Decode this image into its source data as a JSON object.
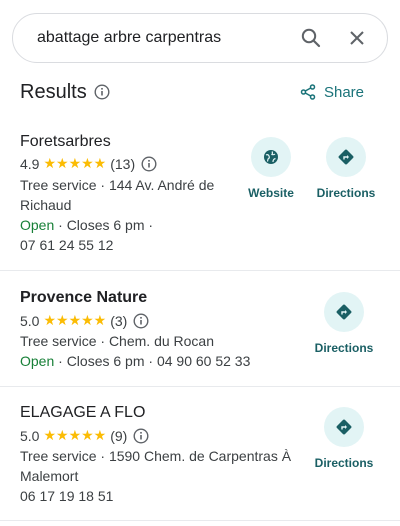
{
  "search": {
    "query": "abattage arbre carpentras"
  },
  "header": {
    "title": "Results",
    "share_label": "Share"
  },
  "actions": {
    "website_label": "Website",
    "directions_label": "Directions"
  },
  "colors": {
    "accent": "#1a7379",
    "open": "#188038",
    "star": "#fbbc04",
    "action_bg": "#e2f4f5"
  },
  "results": [
    {
      "name": "Foretsarbres",
      "rating": "4.9",
      "stars": "★★★★★",
      "review_count": "(13)",
      "line1": "Tree service · 144 Av. André de",
      "line2": "Richaud",
      "status": "Open",
      "hours": " · Closes 6 pm ·",
      "phone": "07 61 24 55 12"
    },
    {
      "name": "Provence Nature",
      "rating": "5.0",
      "stars": "★★★★★",
      "review_count": "(3)",
      "line1": "Tree service · Chem. du Rocan",
      "status": "Open",
      "hours": " · Closes 6 pm · 04 90 60 52 33"
    },
    {
      "name": "ELAGAGE A FLO",
      "rating": "5.0",
      "stars": "★★★★★",
      "review_count": "(9)",
      "line1": "Tree service · 1590 Chem. de Carpentras À",
      "line2": "Malemort",
      "phone": "06 17 19 18 51"
    }
  ]
}
